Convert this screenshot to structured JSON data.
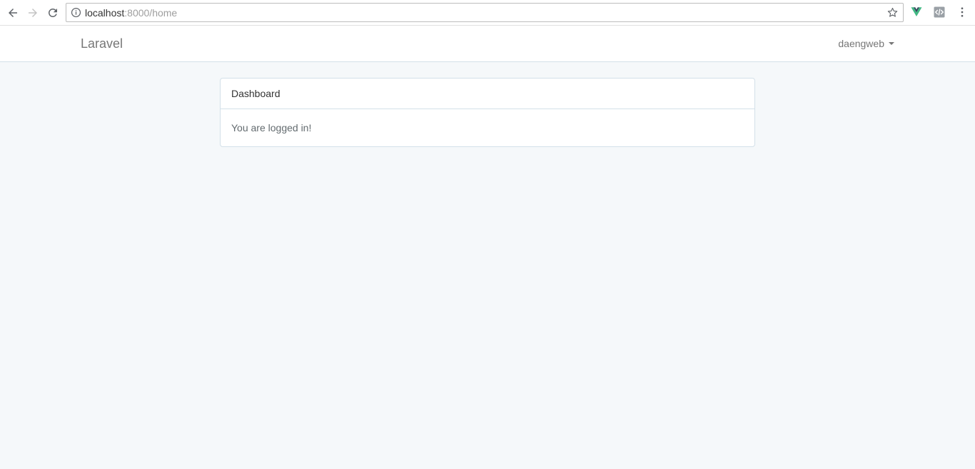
{
  "browser": {
    "url_host": "localhost",
    "url_path": ":8000/home",
    "icons": [
      "back-icon",
      "forward-icon",
      "reload-icon",
      "info-icon",
      "star-icon",
      "vue-devtools-icon",
      "extension-icon",
      "menu-dots-icon"
    ]
  },
  "navbar": {
    "brand": "Laravel",
    "user": "daengweb"
  },
  "panel": {
    "heading": "Dashboard",
    "body": "You are logged in!"
  },
  "colors": {
    "page_bg": "#f5f8fa",
    "border": "#d3e0e9",
    "vue_green": "#41b883",
    "vue_dark": "#35495e"
  }
}
